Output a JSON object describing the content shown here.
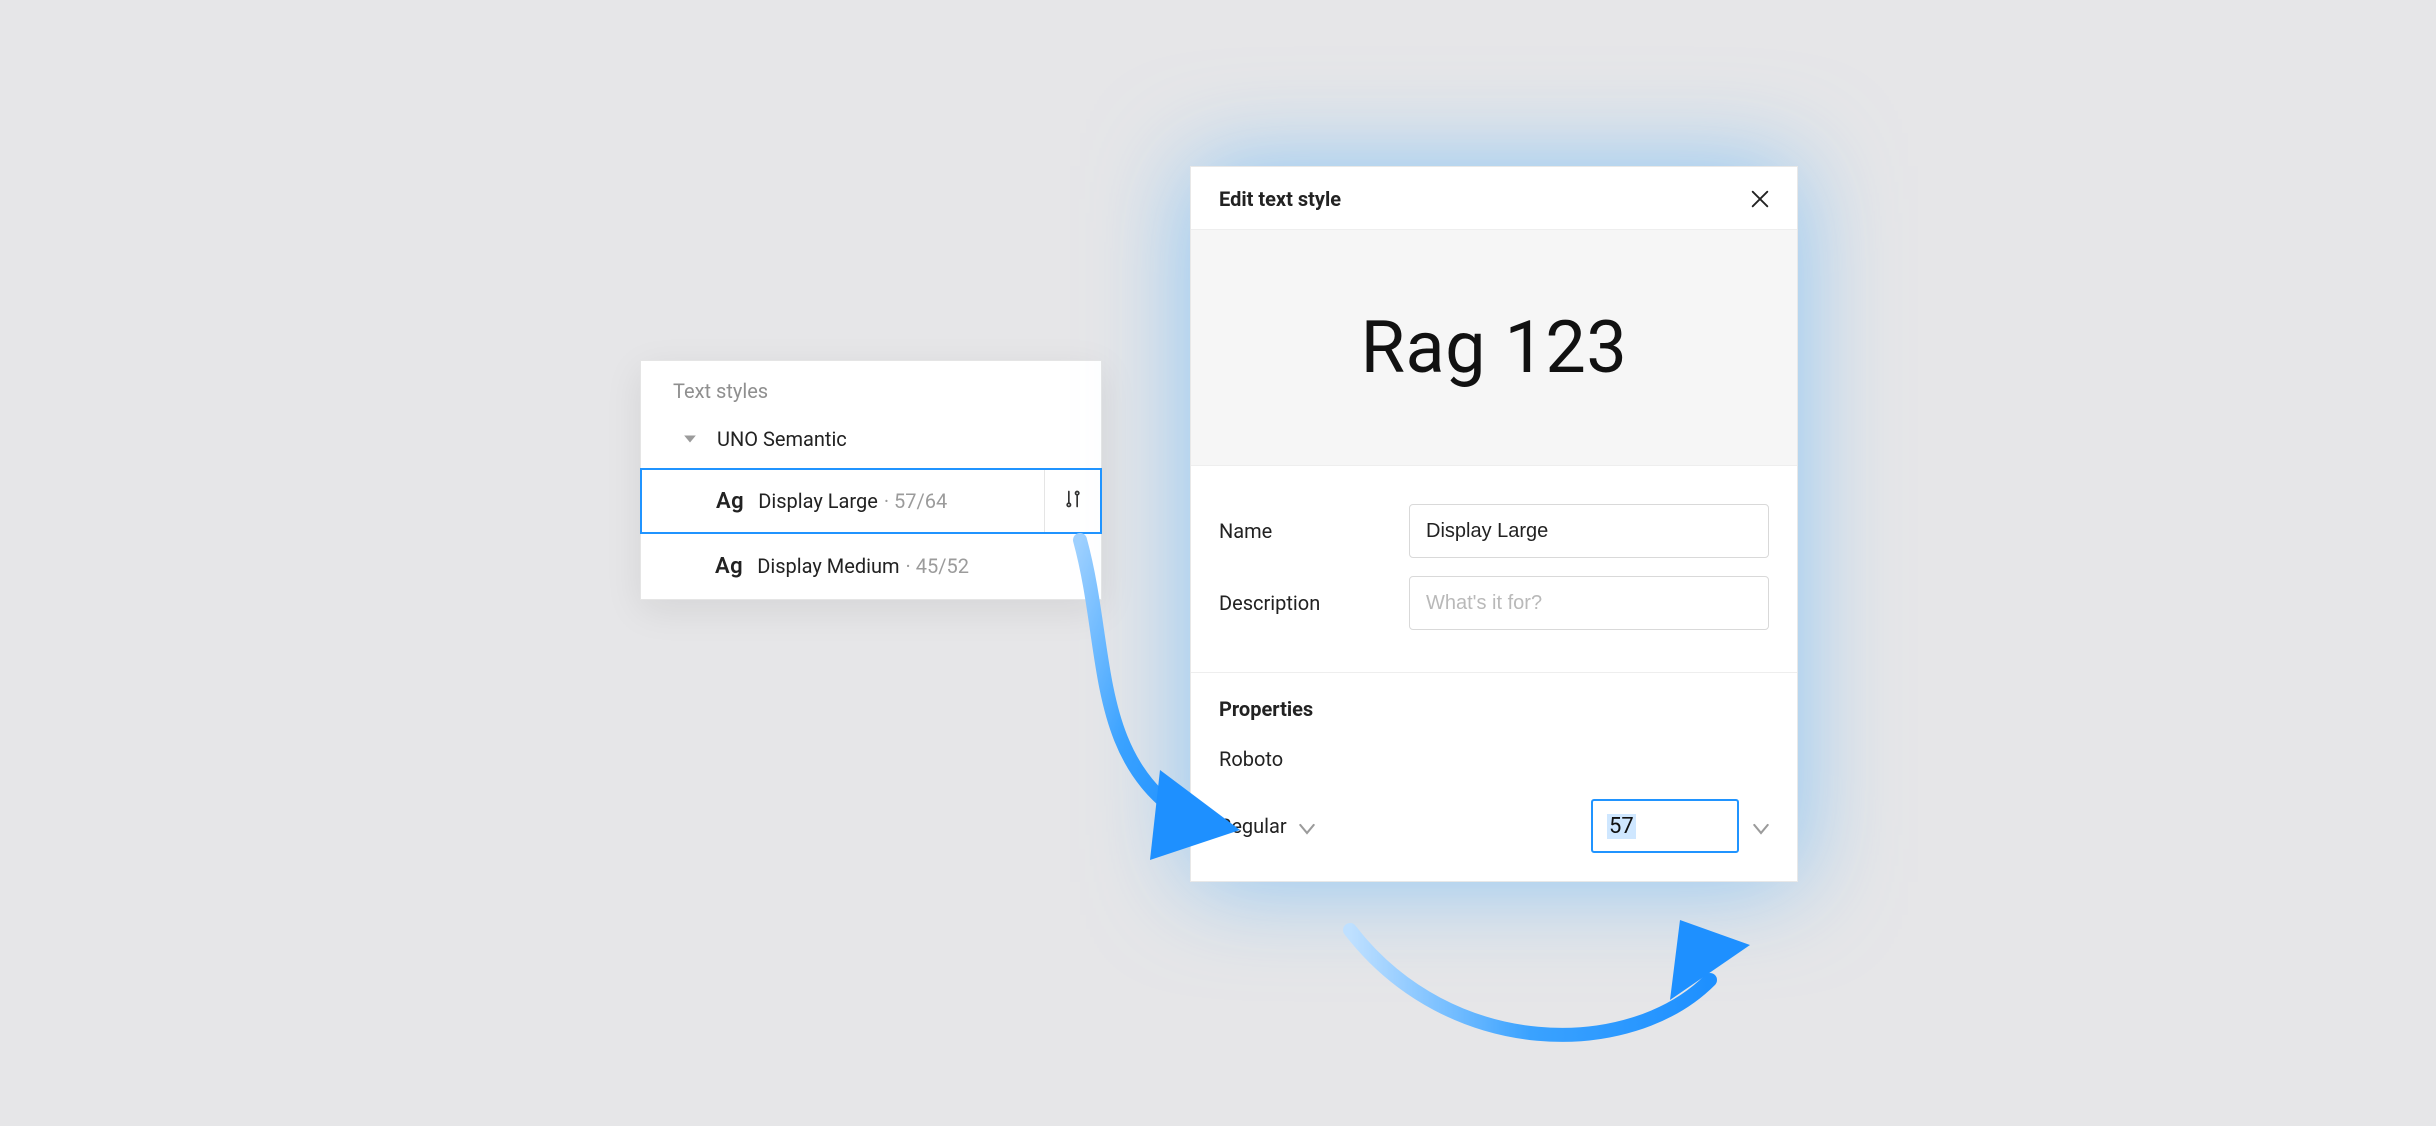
{
  "styles_panel": {
    "header": "Text styles",
    "group": "UNO Semantic",
    "items": [
      {
        "icon": "Ag",
        "name": "Display Large",
        "meta": "· 57/64",
        "selected": true
      },
      {
        "icon": "Ag",
        "name": "Display Medium",
        "meta": "· 45/52",
        "selected": false
      }
    ]
  },
  "edit_panel": {
    "title": "Edit text style",
    "preview": "Rag 123",
    "name_label": "Name",
    "name_value": "Display Large",
    "desc_label": "Description",
    "desc_placeholder": "What's it for?",
    "props_title": "Properties",
    "font_family": "Roboto",
    "font_weight": "Regular",
    "font_size": "57"
  }
}
